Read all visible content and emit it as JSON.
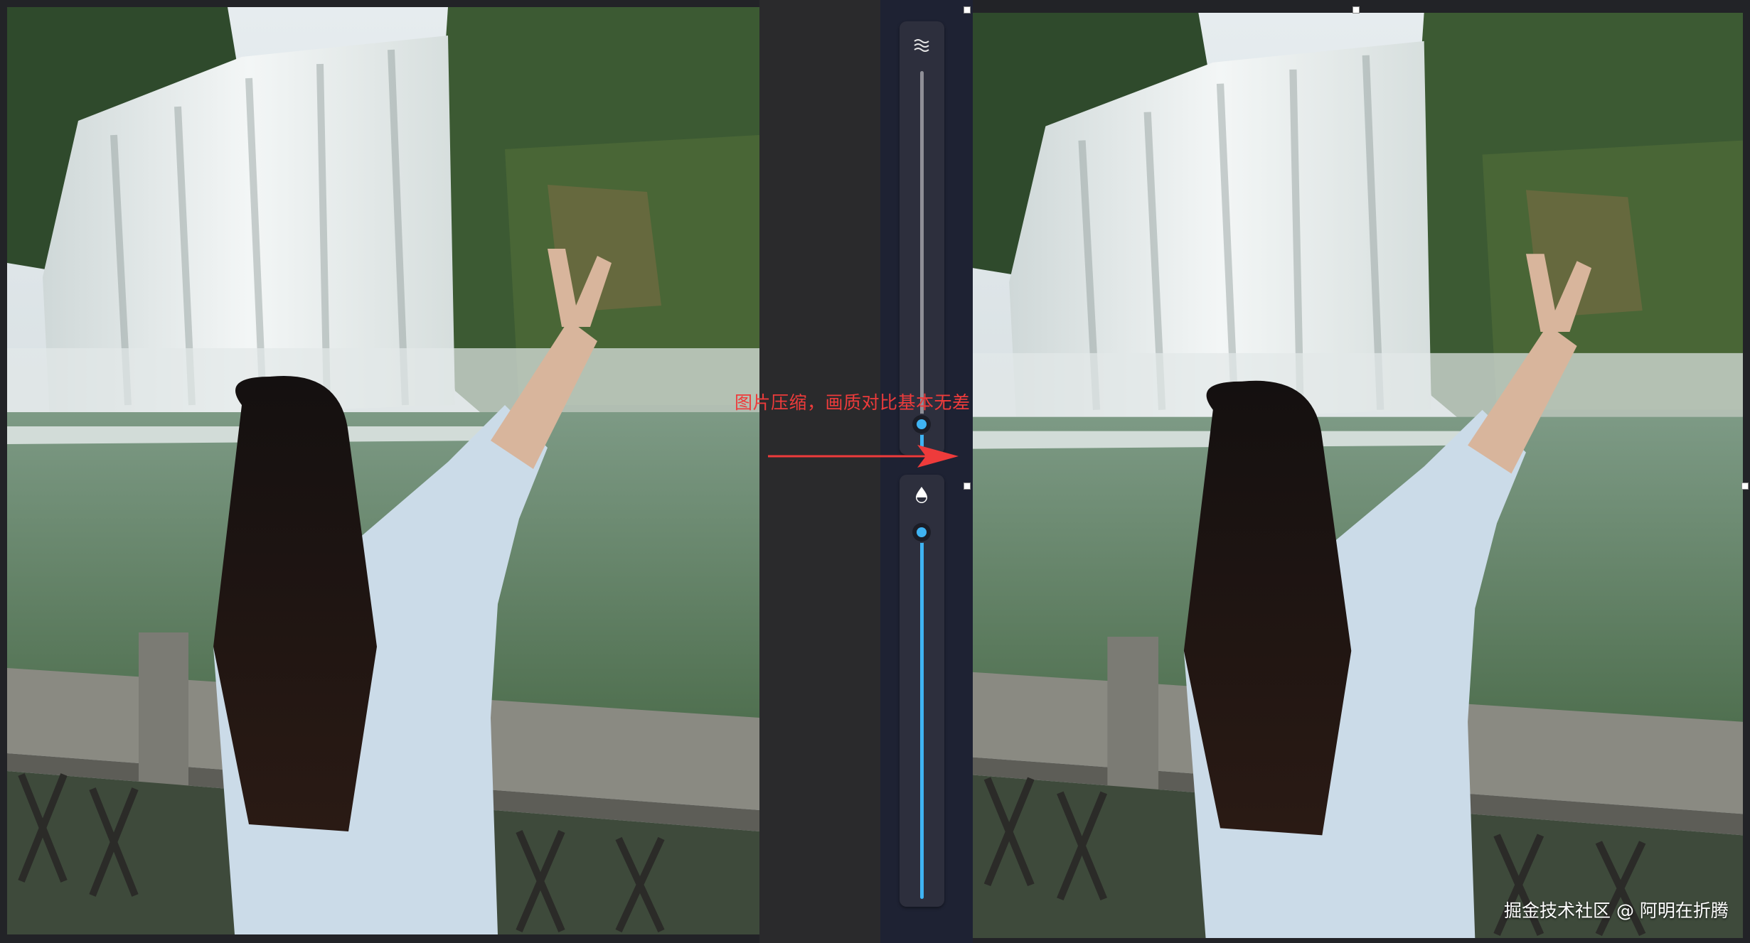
{
  "annotation": {
    "text": "图片压缩，画质对比基本无差"
  },
  "watermark": {
    "text": "掘金技术社区 @ 阿明在折腾"
  },
  "toolbar": {
    "top_icon": "waves-icon",
    "bottom_icon": "droplet-icon",
    "top_slider_level": 0.0,
    "bottom_slider_level": 1.0
  },
  "colors": {
    "accent": "#3fb3f2",
    "annotation": "#ee3b3b",
    "editor_bg": "#1e2233",
    "toolbar_bg": "#2d2f3d"
  },
  "images": [
    {
      "role": "original-photo"
    },
    {
      "role": "compressed-photo"
    }
  ]
}
